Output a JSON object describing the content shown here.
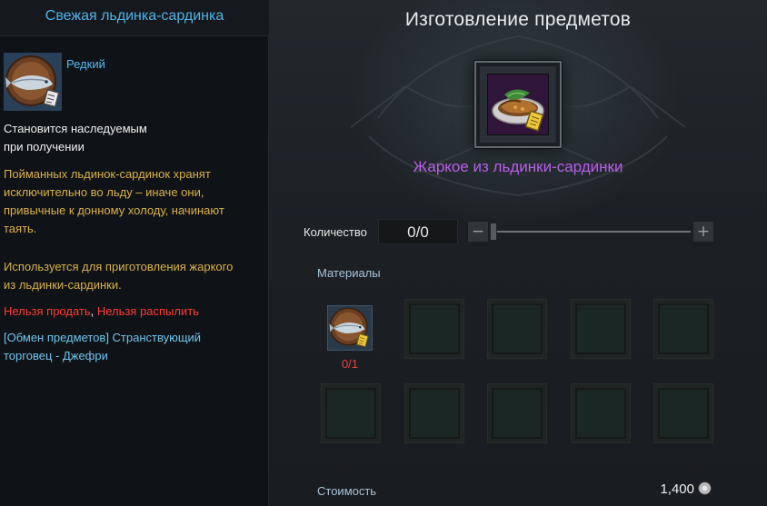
{
  "tooltip": {
    "title": "Свежая льдинка-сардинка",
    "rarity": "Редкий",
    "bind_line1": "Становится наследуемым",
    "bind_line2": "при получении",
    "desc_line1": "Пойманных льдинок-сардинок хранят",
    "desc_line2": "исключительно во льду – иначе они,",
    "desc_line3": "привычные к донному холоду, начинают",
    "desc_line4": "таять.",
    "usage_line1": "Используется для приготовления жаркого",
    "usage_line2": "из льдинки-сардинки.",
    "restriction_sell": "Нельзя продать",
    "restriction_sep": ", ",
    "restriction_disassemble": "Нельзя распылить",
    "source_line1": "[Обмен предметов] Странствующий",
    "source_line2": "торговец - Джефри",
    "icon": "sardine-on-plate-icon"
  },
  "crafting": {
    "title": "Изготовление предметов",
    "result_name": "Жаркое из льдинки-сардинки",
    "result_icon": "roasted-fish-dish-icon",
    "quantity_label": "Количество",
    "quantity_value": "0/0",
    "minus_symbol": "−",
    "plus_symbol": "+",
    "quantity_fraction": 0,
    "materials_label": "Материалы",
    "materials": [
      {
        "icon": "sardine-on-plate-icon",
        "count": "0/1"
      }
    ],
    "empty_slots": 9,
    "cost_label": "Стоимость",
    "cost_value": "1,400",
    "cost_icon": "silver-coin-icon"
  },
  "colors": {
    "rarity_blue": "#58b8ef",
    "title_blue": "#4bb3ea",
    "result_purple": "#b85ee8",
    "lore_gold": "#d9b149",
    "restriction_red": "#ff3b30",
    "source_cyan": "#6fc6ee",
    "count_red": "#e8423c"
  }
}
